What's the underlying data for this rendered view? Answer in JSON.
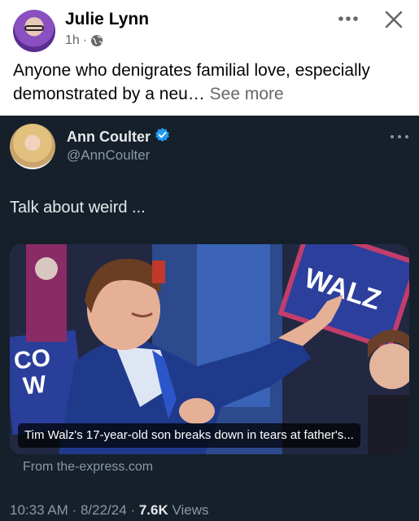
{
  "post": {
    "author": "Julie Lynn",
    "time": "1h",
    "separator": "·",
    "text": "Anyone who denigrates familial love, especially demonstrated by a neu…",
    "see_more": "See more",
    "icons": [
      "globe-icon",
      "more-icon",
      "close-icon"
    ]
  },
  "tweet": {
    "name": "Ann Coulter",
    "handle": "@AnnCoulter",
    "text": "Talk about weird ...",
    "media_caption": "Tim Walz's 17-year-old son breaks down in tears at father's...",
    "source": "From the-express.com",
    "time": "10:33 AM",
    "date": "8/22/24",
    "sep": "·",
    "views_count": "7.6K",
    "views_label": "Views",
    "verified_color": "#1d9bf0",
    "sign_texts": [
      "WALZ",
      "CO",
      "W"
    ]
  },
  "colors": {
    "tweet_bg": "#15202b",
    "muted": "#8b98a5",
    "fb_muted": "#65676b"
  }
}
